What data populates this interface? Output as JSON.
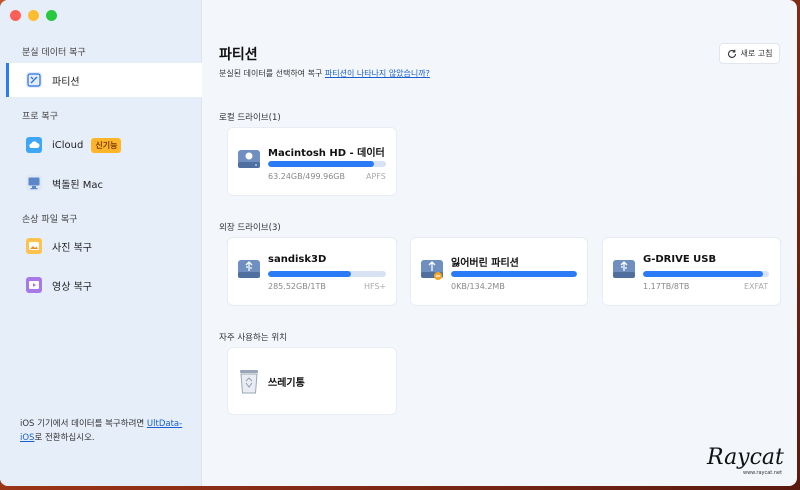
{
  "sidebar": {
    "section_lost": "분실 데이터 복구",
    "item_partition": "파티션",
    "section_pro": "프로 복구",
    "item_icloud": "iCloud",
    "item_icloud_badge": "신기능",
    "item_crashed_mac": "벽돌된 Mac",
    "section_damaged": "손상 파일 복구",
    "item_photo": "사진 복구",
    "item_video": "영상 복구",
    "note_prefix": "iOS 기기에서 데이터를 복구하려면 ",
    "note_link": "UltData-iOS",
    "note_suffix": "로 전환하십시오."
  },
  "main": {
    "title": "파티션",
    "subtitle_prefix": "분실된 데이터를 선택하여 복구 ",
    "subtitle_link": "파티션이 나타나지 않았습니까?",
    "refresh_label": "새로 고침",
    "local_label": "로컬 드라이브(1)",
    "external_label": "외장 드라이브(3)",
    "frequent_label": "자주 사용하는 위치"
  },
  "drives": {
    "local": [
      {
        "name": "Macintosh HD - 데이터",
        "size": "63.24GB/499.96GB",
        "fs": "APFS",
        "used": 0.9
      }
    ],
    "external": [
      {
        "name": "sandisk3D",
        "size": "285.52GB/1TB",
        "fs": "HFS+",
        "used": 0.7
      },
      {
        "name": "잃어버린 파티션",
        "size": "0KB/134.2MB",
        "fs": "",
        "used": 1.0
      },
      {
        "name": "G-DRIVE USB",
        "size": "1.17TB/8TB",
        "fs": "EXFAT",
        "used": 0.95
      }
    ],
    "frequent": [
      {
        "name": "쓰레기통"
      }
    ]
  },
  "watermark": {
    "text": "Raycat",
    "url_text": "www.raycat.net"
  }
}
